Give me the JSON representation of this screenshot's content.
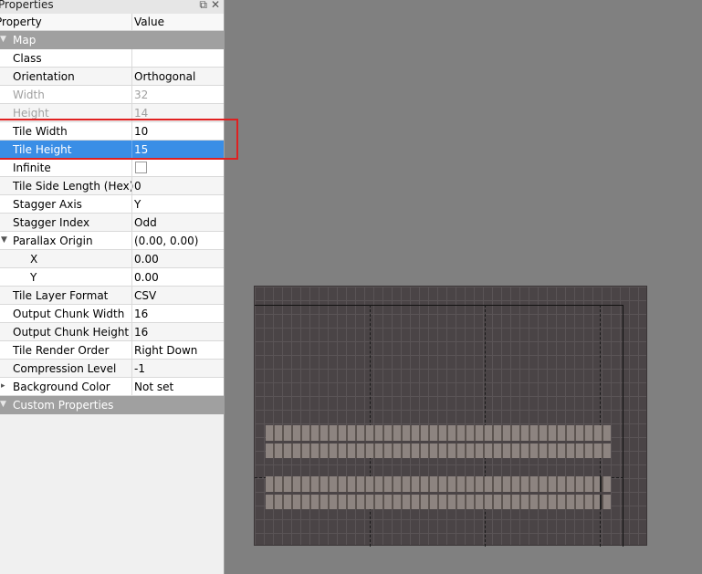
{
  "panel": {
    "title": "Properties",
    "restore_icon": "restore-icon",
    "close_icon": "close-icon",
    "header": {
      "property": "Property",
      "value": "Value"
    }
  },
  "groups": {
    "map": "Map",
    "custom": "Custom Properties"
  },
  "rows": [
    {
      "key": "Class",
      "value": ""
    },
    {
      "key": "Orientation",
      "value": "Orthogonal"
    },
    {
      "key": "Width",
      "value": "32"
    },
    {
      "key": "Height",
      "value": "14"
    },
    {
      "key": "Tile Width",
      "value": "10"
    },
    {
      "key": "Tile Height",
      "value": "15"
    },
    {
      "key": "Infinite",
      "value": ""
    },
    {
      "key": "Tile Side Length (Hex)",
      "value": "0"
    },
    {
      "key": "Stagger Axis",
      "value": "Y"
    },
    {
      "key": "Stagger Index",
      "value": "Odd"
    },
    {
      "key": "Parallax Origin",
      "value": "(0.00, 0.00)"
    },
    {
      "key": "X",
      "value": "0.00"
    },
    {
      "key": "Y",
      "value": "0.00"
    },
    {
      "key": "Tile Layer Format",
      "value": "CSV"
    },
    {
      "key": "Output Chunk Width",
      "value": "16"
    },
    {
      "key": "Output Chunk Height",
      "value": "16"
    },
    {
      "key": "Tile Render Order",
      "value": "Right Down"
    },
    {
      "key": "Compression Level",
      "value": "-1"
    },
    {
      "key": "Background Color",
      "value": "Not set"
    }
  ],
  "colors": {
    "selection": "#3a8ee6",
    "highlight": "#e02020",
    "group": "#a0a0a0",
    "map_bg": "#4a4446"
  }
}
